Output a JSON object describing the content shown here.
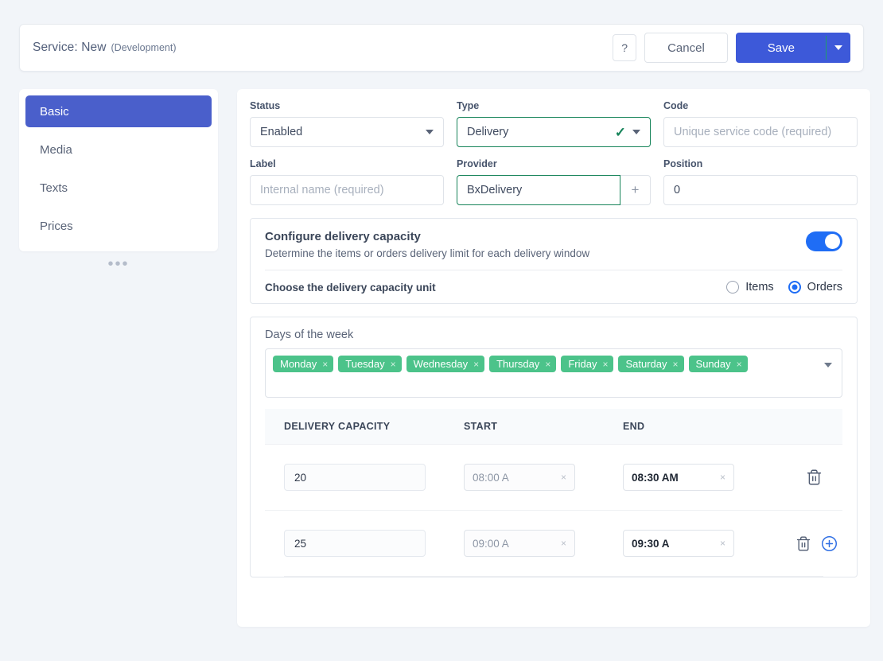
{
  "header": {
    "title_main": "Service: New",
    "title_sub": "(Development)",
    "help_label": "?",
    "cancel_label": "Cancel",
    "save_label": "Save",
    "save_caret_icon": "chevron-down-icon",
    "accent_blue": "#3d59d9",
    "divider_green": "#1f9d6b"
  },
  "sidebar": {
    "items": [
      {
        "label": "Basic",
        "active": true
      },
      {
        "label": "Media",
        "active": false
      },
      {
        "label": "Texts",
        "active": false
      },
      {
        "label": "Prices",
        "active": false
      }
    ],
    "overflow_dots": "•••",
    "active_bg": "#4a5fcb"
  },
  "form": {
    "status": {
      "label": "Status",
      "value": "Enabled",
      "icon": "chevron-down-icon"
    },
    "type": {
      "label": "Type",
      "value": "Delivery",
      "valid_icon": "check-icon",
      "icon": "chevron-down-icon",
      "border_color": "#17845a"
    },
    "code": {
      "label": "Code",
      "value": "",
      "placeholder": "Unique service code (required)"
    },
    "field_label": {
      "label": "Label",
      "value": "",
      "placeholder": "Internal name (required)"
    },
    "provider": {
      "label": "Provider",
      "value": "BxDelivery",
      "add_icon": "plus-icon",
      "border_color": "#17845a"
    },
    "position": {
      "label": "Position",
      "value": "0"
    }
  },
  "capacity": {
    "title": "Configure delivery capacity",
    "description": "Determine the items or orders delivery limit for each delivery window",
    "toggle_on": true,
    "toggle_color": "#1f6df5",
    "unit_label": "Choose the delivery capacity unit",
    "options": [
      {
        "label": "Items",
        "selected": false
      },
      {
        "label": "Orders",
        "selected": true
      }
    ]
  },
  "schedule": {
    "days_label": "Days of the week",
    "days": [
      {
        "label": "Monday",
        "remove": "×"
      },
      {
        "label": "Tuesday",
        "remove": "×"
      },
      {
        "label": "Wednesday",
        "remove": "×"
      },
      {
        "label": "Thursday",
        "remove": "×"
      },
      {
        "label": "Friday",
        "remove": "×"
      },
      {
        "label": "Saturday",
        "remove": "×"
      },
      {
        "label": "Sunday",
        "remove": "×"
      }
    ],
    "tag_color": "#4cc38a",
    "dropdown_icon": "chevron-down-icon",
    "columns": [
      "DELIVERY CAPACITY",
      "START",
      "END"
    ],
    "rows": [
      {
        "capacity": "20",
        "start": "08:00 A",
        "start_clear": "×",
        "end": "08:30 AM",
        "end_clear": "×",
        "delete_icon": "trash-icon",
        "has_add": false
      },
      {
        "capacity": "25",
        "start": "09:00 A",
        "start_clear": "×",
        "end": "09:30 A",
        "end_clear": "×",
        "delete_icon": "trash-icon",
        "has_add": true,
        "add_icon": "plus-circle-icon"
      }
    ]
  }
}
